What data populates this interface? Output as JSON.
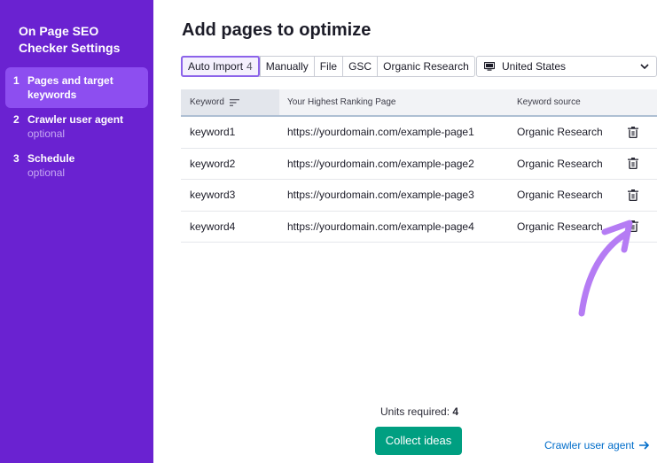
{
  "sidebar": {
    "title": "On Page SEO Checker Settings",
    "steps": [
      {
        "num": "1",
        "label": "Pages and target keywords",
        "sub": ""
      },
      {
        "num": "2",
        "label": "Crawler user agent",
        "sub": "optional"
      },
      {
        "num": "3",
        "label": "Schedule",
        "sub": "optional"
      }
    ]
  },
  "main": {
    "title": "Add pages to optimize",
    "tabs": [
      {
        "label": "Auto Import",
        "badge": "4"
      },
      {
        "label": "Manually"
      },
      {
        "label": "File"
      },
      {
        "label": "GSC"
      },
      {
        "label": "Organic Research"
      }
    ],
    "country": {
      "value": "United States",
      "icon": "monitor-icon"
    }
  },
  "table": {
    "headers": {
      "keyword": "Keyword",
      "page": "Your Highest Ranking Page",
      "source": "Keyword source"
    },
    "rows": [
      {
        "keyword": "keyword1",
        "page": "https://yourdomain.com/example-page1",
        "source": "Organic Research"
      },
      {
        "keyword": "keyword2",
        "page": "https://yourdomain.com/example-page2",
        "source": "Organic Research"
      },
      {
        "keyword": "keyword3",
        "page": "https://yourdomain.com/example-page3",
        "source": "Organic Research"
      },
      {
        "keyword": "keyword4",
        "page": "https://yourdomain.com/example-page4",
        "source": "Organic Research"
      }
    ]
  },
  "footer": {
    "units_label": "Units required:",
    "units_value": "4",
    "collect_label": "Collect ideas",
    "next_label": "Crawler user agent"
  },
  "colors": {
    "sidebar": "#6a22d1",
    "sidebar_active": "#8d4ef0",
    "primary_button": "#009f81",
    "link": "#006dca",
    "annotation_arrow": "#b57cf4"
  }
}
